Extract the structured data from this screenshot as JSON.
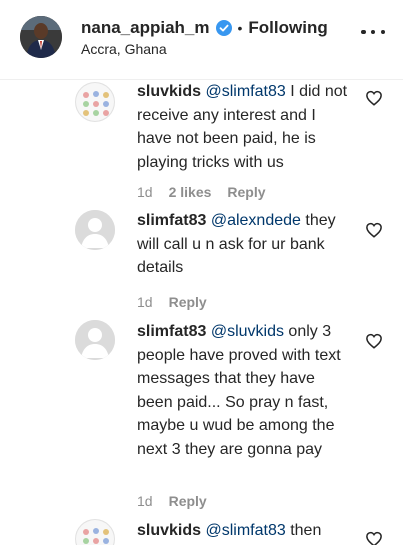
{
  "header": {
    "username": "nana_appiah_m",
    "separator": "•",
    "follow_label": "Following",
    "location": "Accra, Ghana",
    "icons": {
      "verified": "verified-badge-icon",
      "more": "more-options-icon"
    },
    "colors": {
      "verified": "#3897f0",
      "text": "#262626"
    }
  },
  "comments": [
    {
      "user": "sluvkids",
      "mention": "@slimfat83",
      "text": " I did not receive any interest and I have not been paid, he is playing tricks with us",
      "time": "1d",
      "likes": "2 likes",
      "reply": "Reply"
    },
    {
      "user": "slimfat83",
      "mention": "@alexndede",
      "text": " they will call u n ask for ur bank details",
      "time": "1d",
      "reply": "Reply"
    },
    {
      "user": "slimfat83",
      "mention": "@sluvkids",
      "text": " only 3 people have proved with text messages that they have been paid... So pray n fast, maybe u wud be among the next 3 they are gonna pay",
      "time": "1d",
      "reply": "Reply"
    },
    {
      "user": "sluvkids",
      "mention": "@slimfat83",
      "text": " then"
    }
  ],
  "icons": {
    "heart": "heart-outline-icon",
    "avatar_placeholder": "default-avatar-icon"
  },
  "colors": {
    "mention": "#00376b",
    "meta": "#8e8e8e",
    "divider": "#efefef"
  }
}
